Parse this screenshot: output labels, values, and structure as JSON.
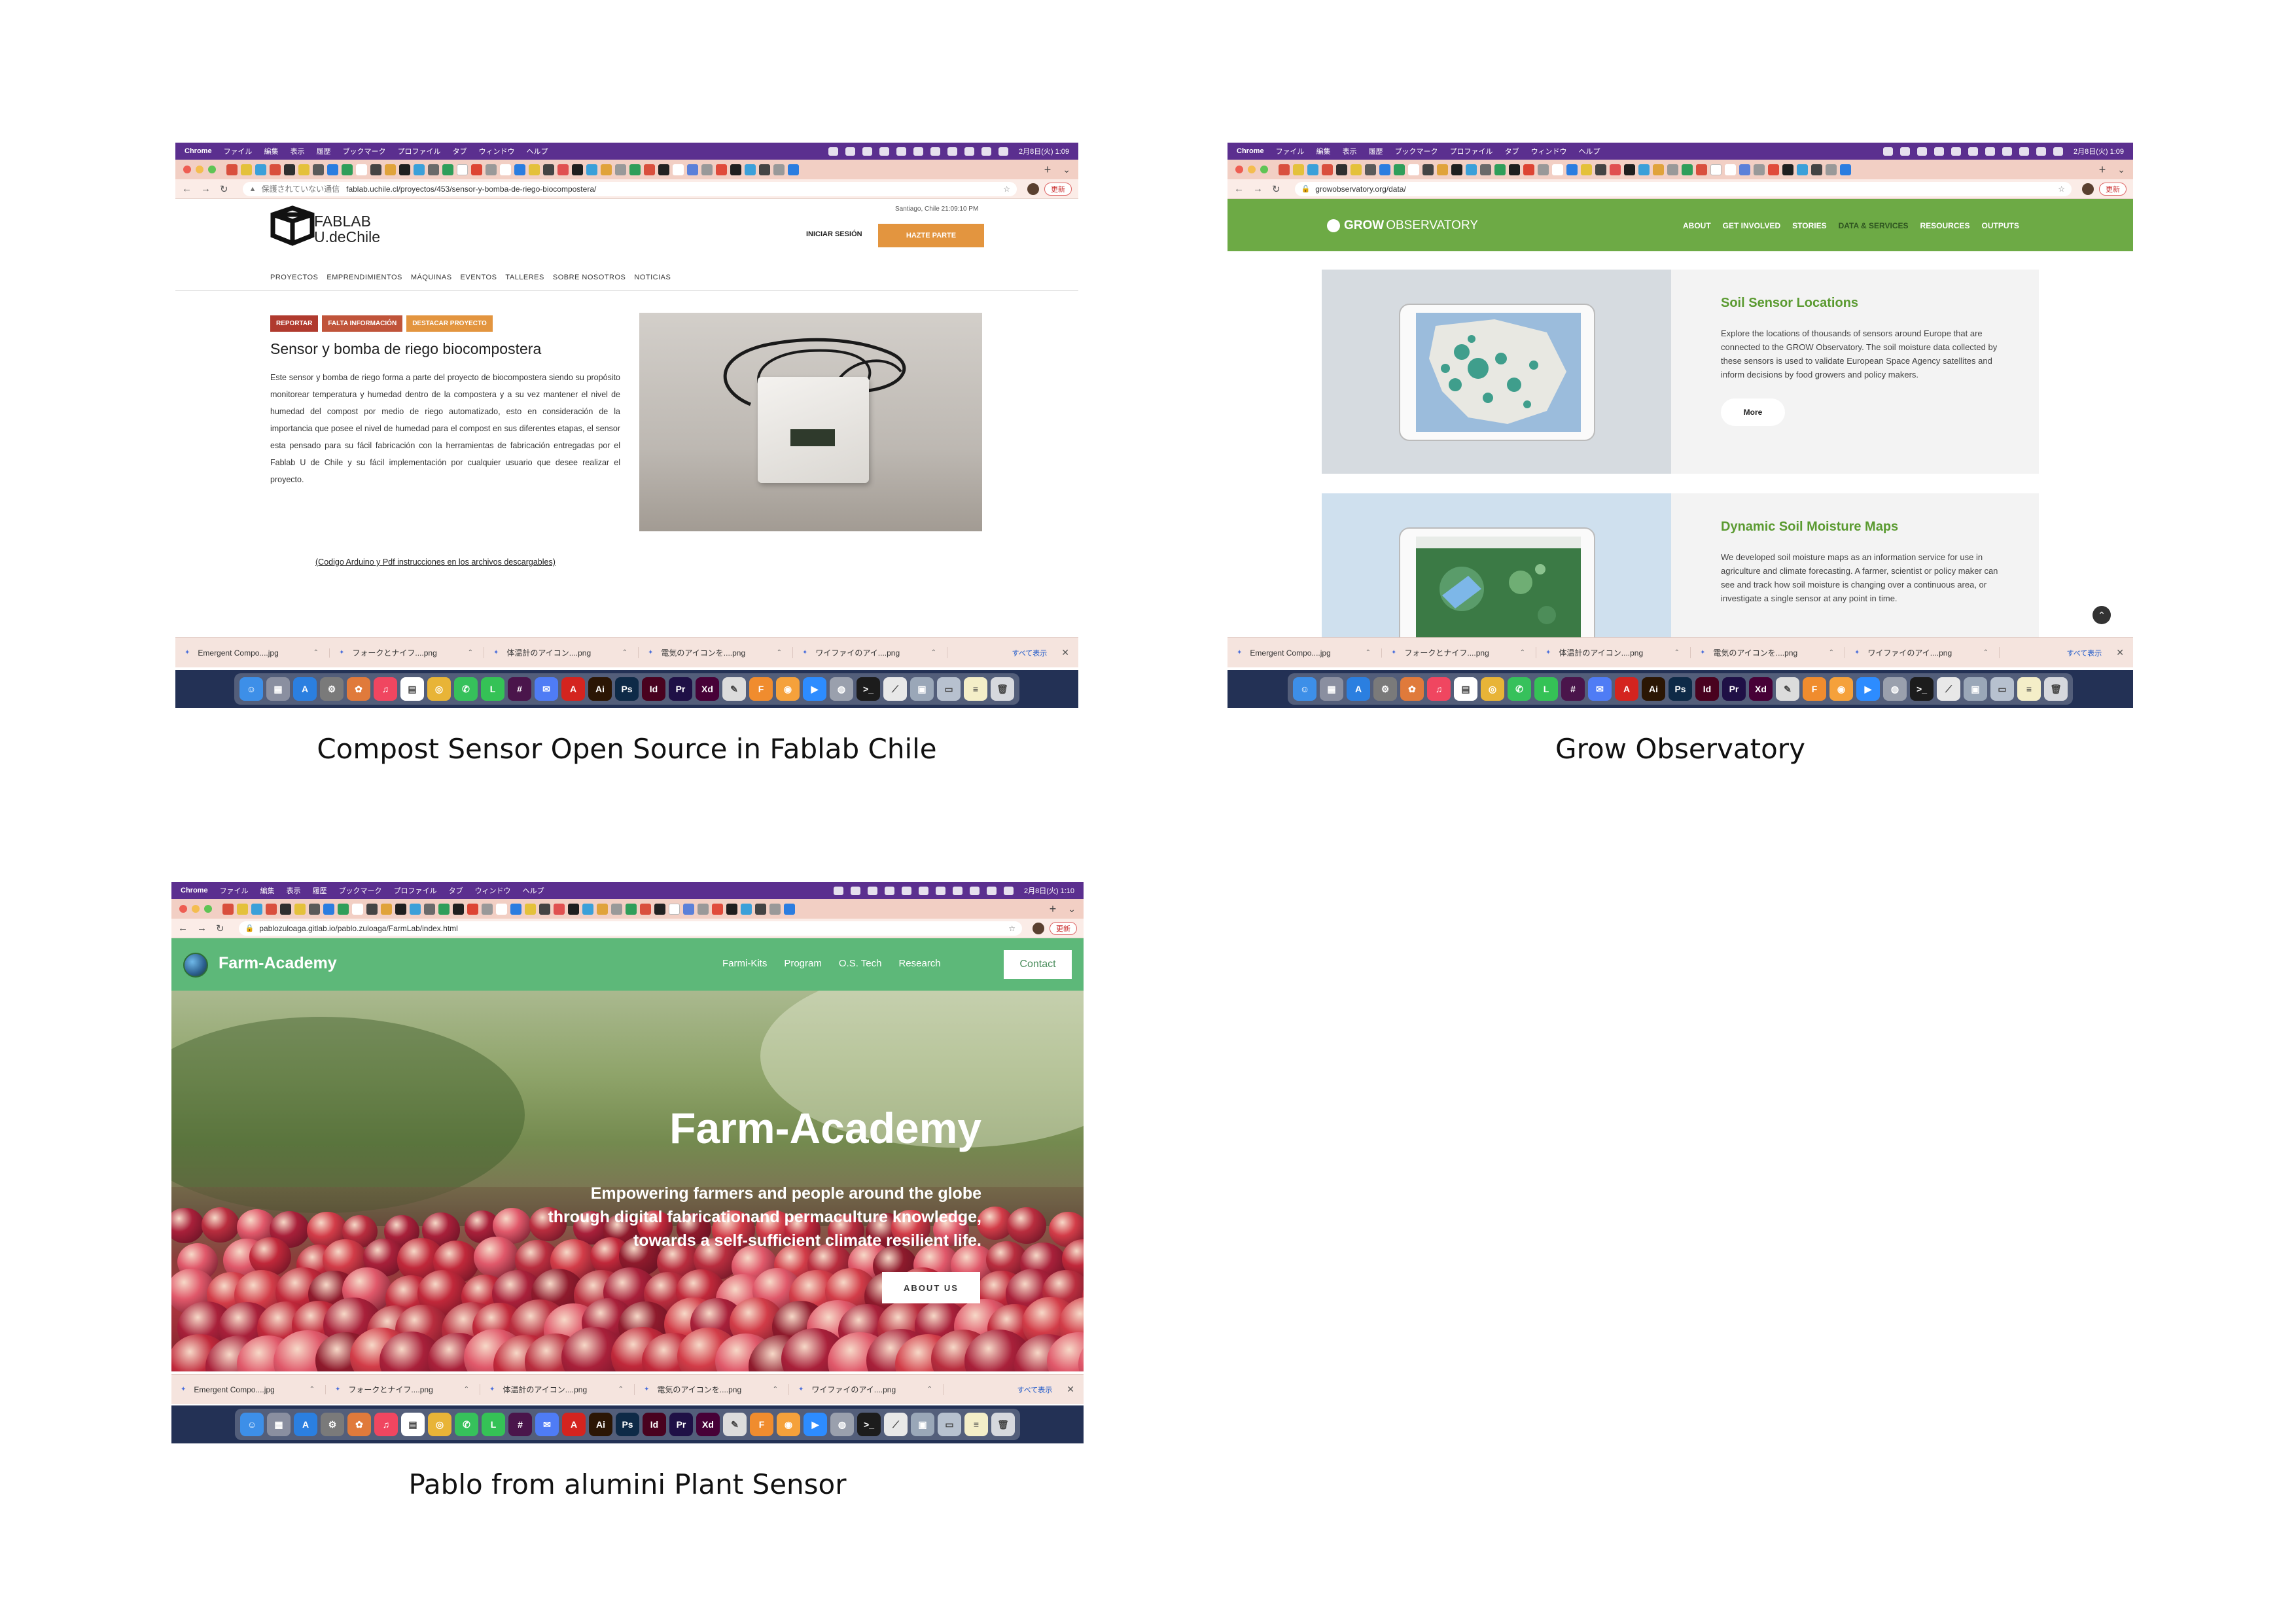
{
  "captions": {
    "fablab": "Compost Sensor Open Source in Fablab Chile",
    "grow": "Grow Observatory",
    "farm": "Pablo from alumini Plant Sensor"
  },
  "menubar": {
    "app": "Chrome",
    "items": [
      "ファイル",
      "編集",
      "表示",
      "履歴",
      "ブックマーク",
      "プロファイル",
      "タブ",
      "ウィンドウ",
      "ヘルプ"
    ],
    "clock_fablab": "2月8日(火) 1:09",
    "clock_grow": "2月8日(火) 1:09",
    "clock_farm": "2月8日(火) 1:10"
  },
  "browser": {
    "update_label": "更新",
    "insecure_label": "保護されていない通信"
  },
  "downloads": {
    "items": [
      "Emergent Compo....jpg",
      "フォークとナイフ....png",
      "体温計のアイコン....png",
      "電気のアイコンを....png",
      "ワイファイのアイ....png"
    ],
    "items_farm": [
      "Emergent Compo....jpg",
      "フォークとナイフ....png",
      "体温計のアイコン....png",
      "電気のアイコンを....png",
      "ワイファイのアイ....png"
    ],
    "show_all": "すべて表示"
  },
  "fablab": {
    "url": "fablab.uchile.cl/proyectos/453/sensor-y-bomba-de-riego-biocompostera/",
    "logo_line1": "FABLAB",
    "logo_line2": "U.deChile",
    "datetime": "Santiago, Chile 21:09:10 PM",
    "login": "INICIAR SESIÓN",
    "join": "HAZTE PARTE",
    "nav": [
      "PROYECTOS",
      "EMPRENDIMIENTOS",
      "MÁQUINAS",
      "EVENTOS",
      "TALLERES",
      "SOBRE NOSOTROS",
      "NOTICIAS"
    ],
    "tags": [
      {
        "label": "REPORTAR",
        "color": "#b03a2e"
      },
      {
        "label": "FALTA INFORMACIÓN",
        "color": "#c0543a"
      },
      {
        "label": "DESTACAR PROYECTO",
        "color": "#e3953f"
      }
    ],
    "title": "Sensor y bomba de riego biocompostera",
    "description": "Este sensor y bomba de riego forma a parte del proyecto de biocompostera siendo su propósito monitorear temperatura y humedad dentro de la compostera y a su vez mantener el nivel de humedad del compost por medio de riego automatizado, esto en consideración de la importancia que posee el nivel de humedad para el compost en sus diferentes etapas, el sensor esta pensado para su fácil fabricación con la herramientas de fabricación entregadas por el Fablab U de Chile y su fácil implementación por cualquier usuario que desee realizar el proyecto.",
    "code_link": "(Codigo Arduino y Pdf instrucciones en los archivos descargables)"
  },
  "grow": {
    "url": "growobservatory.org/data/",
    "logo_bold": "GROW",
    "logo_rest": "OBSERVATORY",
    "nav": [
      "ABOUT",
      "GET INVOLVED",
      "STORIES",
      "DATA & SERVICES",
      "RESOURCES",
      "OUTPUTS"
    ],
    "active_nav": "DATA & SERVICES",
    "cards": [
      {
        "title": "Soil Sensor Locations",
        "body": "Explore the locations of thousands of sensors around Europe that are connected to the GROW Observatory. The soil moisture data collected by these sensors is used to validate European Space Agency satellites and inform decisions by food growers and policy makers.",
        "button": "More"
      },
      {
        "title": "Dynamic Soil Moisture Maps",
        "body": "We developed soil moisture maps as an information service for use in agriculture and climate forecasting. A farmer, scientist or policy maker can see and track how soil moisture is changing over a continuous area, or investigate a single sensor at any point in time."
      }
    ]
  },
  "farm": {
    "url": "pablozuloaga.gitlab.io/pablo.zuloaga/FarmLab/index.html",
    "brand": "Farm-Academy",
    "nav": [
      "Farmi-Kits",
      "Program",
      "O.S. Tech",
      "Research"
    ],
    "contact": "Contact",
    "hero_title": "Farm-Academy",
    "hero_sub_lines": [
      "Empowering farmers and people around the globe",
      "through digital fabricationand permaculture knowledge,",
      "towards a self-sufficient climate resilient life."
    ],
    "about_button": "ABOUT US"
  },
  "dock": {
    "icons": [
      {
        "name": "finder-icon",
        "color": "#3d8fe8",
        "glyph": "☺"
      },
      {
        "name": "launchpad-icon",
        "color": "#8a8fa0",
        "glyph": "▦"
      },
      {
        "name": "app-store-icon",
        "color": "#2b7fe0",
        "glyph": "A"
      },
      {
        "name": "system-prefs-icon",
        "color": "#7a7a7a",
        "glyph": "⚙"
      },
      {
        "name": "photos-icon",
        "color": "#e07a3b",
        "glyph": "✿"
      },
      {
        "name": "music-icon",
        "color": "#f04660",
        "glyph": "♫"
      },
      {
        "name": "calendar-icon",
        "color": "#ffffff",
        "glyph": "▤"
      },
      {
        "name": "chrome-icon",
        "color": "#e8b437",
        "glyph": "◎"
      },
      {
        "name": "whatsapp-icon",
        "color": "#36c15b",
        "glyph": "✆"
      },
      {
        "name": "line-icon",
        "color": "#35c256",
        "glyph": "L"
      },
      {
        "name": "slack-icon",
        "color": "#4a154b",
        "glyph": "#"
      },
      {
        "name": "messenger-icon",
        "color": "#4f7cf5",
        "glyph": "✉"
      },
      {
        "name": "acrobat-icon",
        "color": "#d4241f",
        "glyph": "A"
      },
      {
        "name": "illustrator-icon",
        "color": "#2b1604",
        "glyph": "Ai"
      },
      {
        "name": "photoshop-icon",
        "color": "#0e2a47",
        "glyph": "Ps"
      },
      {
        "name": "indesign-icon",
        "color": "#49021f",
        "glyph": "Id"
      },
      {
        "name": "premiere-icon",
        "color": "#1f1046",
        "glyph": "Pr"
      },
      {
        "name": "xd-icon",
        "color": "#470137",
        "glyph": "Xd"
      },
      {
        "name": "inkscape-icon",
        "color": "#dcdcdc",
        "glyph": "✎"
      },
      {
        "name": "fusion-icon",
        "color": "#f08c2e",
        "glyph": "F"
      },
      {
        "name": "blender-icon",
        "color": "#f5a13b",
        "glyph": "◉"
      },
      {
        "name": "zoom-icon",
        "color": "#2d8cff",
        "glyph": "▶"
      },
      {
        "name": "network-icon",
        "color": "#9aa0ad",
        "glyph": "◍"
      },
      {
        "name": "terminal-icon",
        "color": "#1c1c1c",
        "glyph": ">_"
      },
      {
        "name": "preview-icon",
        "color": "#e8e8e8",
        "glyph": "⟋"
      },
      {
        "name": "folder-icon",
        "color": "#9aa7b8",
        "glyph": "▣"
      },
      {
        "name": "screens-icon",
        "color": "#b7c1cf",
        "glyph": "▭"
      },
      {
        "name": "notes-icon",
        "color": "#f4eec8",
        "glyph": "≡"
      },
      {
        "name": "trash-icon",
        "color": "#d6d8dd",
        "glyph": "🗑"
      }
    ]
  },
  "tab_favicon_colors": [
    "#d94f3d",
    "#e4c13b",
    "#3ba0d9",
    "#d94f3d",
    "#2f2f2f",
    "#e4c13b",
    "#5a5a5a",
    "#2b7de0",
    "#2f9e5a",
    "#ffffff",
    "#444",
    "#e0a33b",
    "#1f1f1f",
    "#3ba0d9",
    "#6a6a6a",
    "#2f9e5a",
    "#1f1f1f",
    "#dd4433",
    "#999",
    "#ffffff",
    "#2b7de0",
    "#e4c13b",
    "#444",
    "#e05050",
    "#1f1f1f",
    "#3ba0d9",
    "#e0a33b",
    "#999",
    "#2f9e5a",
    "#d94f3d",
    "#222",
    "#ffffff",
    "#5b80d9",
    "#999",
    "#e04b3b",
    "#1f1f1f",
    "#3ba0d9",
    "#444",
    "#999",
    "#2b7de0"
  ]
}
